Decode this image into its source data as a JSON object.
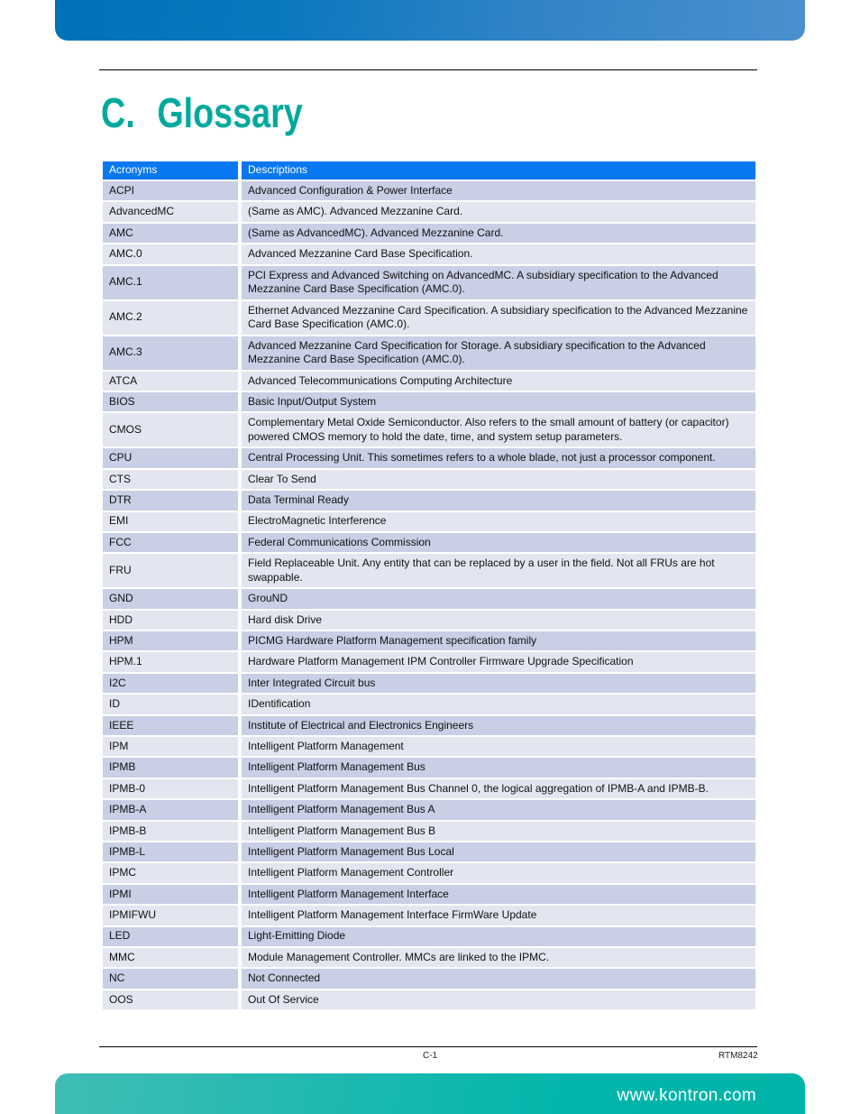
{
  "header": {
    "chapter": "C.",
    "title": "Glossary"
  },
  "table": {
    "columns": [
      "Acronyms",
      "Descriptions"
    ],
    "rows": [
      [
        "ACPI",
        "Advanced Configuration & Power Interface"
      ],
      [
        "AdvancedMC",
        "(Same as AMC). Advanced Mezzanine Card."
      ],
      [
        "AMC",
        "(Same as AdvancedMC). Advanced Mezzanine Card."
      ],
      [
        "AMC.0",
        "Advanced Mezzanine Card Base Specification."
      ],
      [
        "AMC.1",
        "PCI Express and Advanced Switching on AdvancedMC. A subsidiary specification to the Advanced Mezzanine Card Base Specification (AMC.0)."
      ],
      [
        "AMC.2",
        "Ethernet Advanced Mezzanine Card Specification. A subsidiary specification to the Advanced Mezzanine Card Base Specification (AMC.0)."
      ],
      [
        "AMC.3",
        "Advanced Mezzanine Card Specification for Storage. A subsidiary specification to the Advanced Mezzanine Card Base Specification (AMC.0)."
      ],
      [
        "ATCA",
        "Advanced Telecommunications Computing Architecture"
      ],
      [
        "BIOS",
        "Basic Input/Output System"
      ],
      [
        "CMOS",
        "Complementary Metal Oxide Semiconductor. Also refers to the small amount of battery (or capacitor) powered CMOS memory to hold the date, time, and system setup parameters."
      ],
      [
        "CPU",
        "Central Processing Unit. This sometimes refers to a whole blade, not just a processor component."
      ],
      [
        "CTS",
        "Clear To Send"
      ],
      [
        "DTR",
        "Data Terminal Ready"
      ],
      [
        "EMI",
        "ElectroMagnetic Interference"
      ],
      [
        "FCC",
        "Federal Communications Commission"
      ],
      [
        "FRU",
        "Field Replaceable Unit. Any entity that can be replaced by a user in the field. Not all FRUs are hot swappable."
      ],
      [
        "GND",
        "GrouND"
      ],
      [
        "HDD",
        "Hard disk Drive"
      ],
      [
        "HPM",
        "PICMG Hardware Platform Management specification family"
      ],
      [
        "HPM.1",
        "Hardware Platform Management IPM Controller Firmware Upgrade Specification"
      ],
      [
        "I2C",
        "Inter Integrated Circuit bus"
      ],
      [
        "ID",
        "IDentification"
      ],
      [
        "IEEE",
        "Institute of Electrical and Electronics Engineers"
      ],
      [
        "IPM",
        "Intelligent Platform Management"
      ],
      [
        "IPMB",
        "Intelligent Platform Management Bus"
      ],
      [
        "IPMB-0",
        "Intelligent Platform Management Bus Channel 0, the logical aggregation of IPMB-A and IPMB-B."
      ],
      [
        "IPMB-A",
        "Intelligent Platform Management Bus A"
      ],
      [
        "IPMB-B",
        "Intelligent Platform Management Bus B"
      ],
      [
        "IPMB-L",
        "Intelligent Platform Management Bus Local"
      ],
      [
        "IPMC",
        "Intelligent Platform Management Controller"
      ],
      [
        "IPMI",
        "Intelligent Platform Management Interface"
      ],
      [
        "IPMIFWU",
        "Intelligent Platform Management Interface FirmWare Update"
      ],
      [
        "LED",
        "Light-Emitting Diode"
      ],
      [
        "MMC",
        "Module Management Controller. MMCs are linked to the IPMC."
      ],
      [
        "NC",
        "Not Connected"
      ],
      [
        "OOS",
        "Out Of Service"
      ]
    ]
  },
  "footer": {
    "page": "C-1",
    "document": "RTM8242",
    "url": "www.kontron.com"
  },
  "colors": {
    "header_bg": "#0a78f0",
    "row_odd": "#c9cfe4",
    "row_even": "#e3e6f0",
    "title": "#00a99d"
  }
}
